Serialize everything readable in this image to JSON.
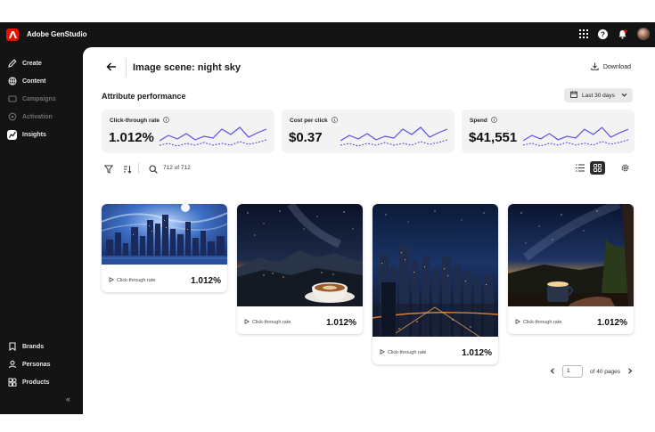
{
  "app": {
    "title": "Adobe GenStudio"
  },
  "sidebar": {
    "items": [
      {
        "label": "Create",
        "icon": "pencil-icon",
        "state": "normal"
      },
      {
        "label": "Content",
        "icon": "globe-icon",
        "state": "normal"
      },
      {
        "label": "Campaigns",
        "icon": "campaign-icon",
        "state": "disabled"
      },
      {
        "label": "Activation",
        "icon": "activation-icon",
        "state": "disabled"
      },
      {
        "label": "Insights",
        "icon": "chart-icon",
        "state": "active"
      }
    ],
    "bottom_items": [
      {
        "label": "Brands",
        "icon": "brand-icon"
      },
      {
        "label": "Personas",
        "icon": "persona-icon"
      },
      {
        "label": "Products",
        "icon": "product-icon"
      }
    ],
    "collapse_label": "«"
  },
  "header": {
    "title": "Image scene: night sky",
    "download_label": "Download"
  },
  "section": {
    "title": "Attribute performance",
    "date_range": "Last 30 days"
  },
  "metrics": [
    {
      "label": "Click-through rate",
      "value": "1.012%"
    },
    {
      "label": "Cost per click",
      "value": "$0.37"
    },
    {
      "label": "Spend",
      "value": "$41,551"
    }
  ],
  "toolbar": {
    "count_text": "712 of 712"
  },
  "cards": [
    {
      "metric_label": "Click-through rate",
      "value": "1.012%"
    },
    {
      "metric_label": "Click-through rate",
      "value": "1.012%"
    },
    {
      "metric_label": "Click-through rate",
      "value": "1.012%"
    },
    {
      "metric_label": "Click-through rate",
      "value": "1.012%"
    }
  ],
  "pagination": {
    "current_page": "1",
    "total_text": "of 40 pages"
  },
  "colors": {
    "accent": "#5b4ee6",
    "brand": "#eb1000",
    "dark": "#141414"
  }
}
